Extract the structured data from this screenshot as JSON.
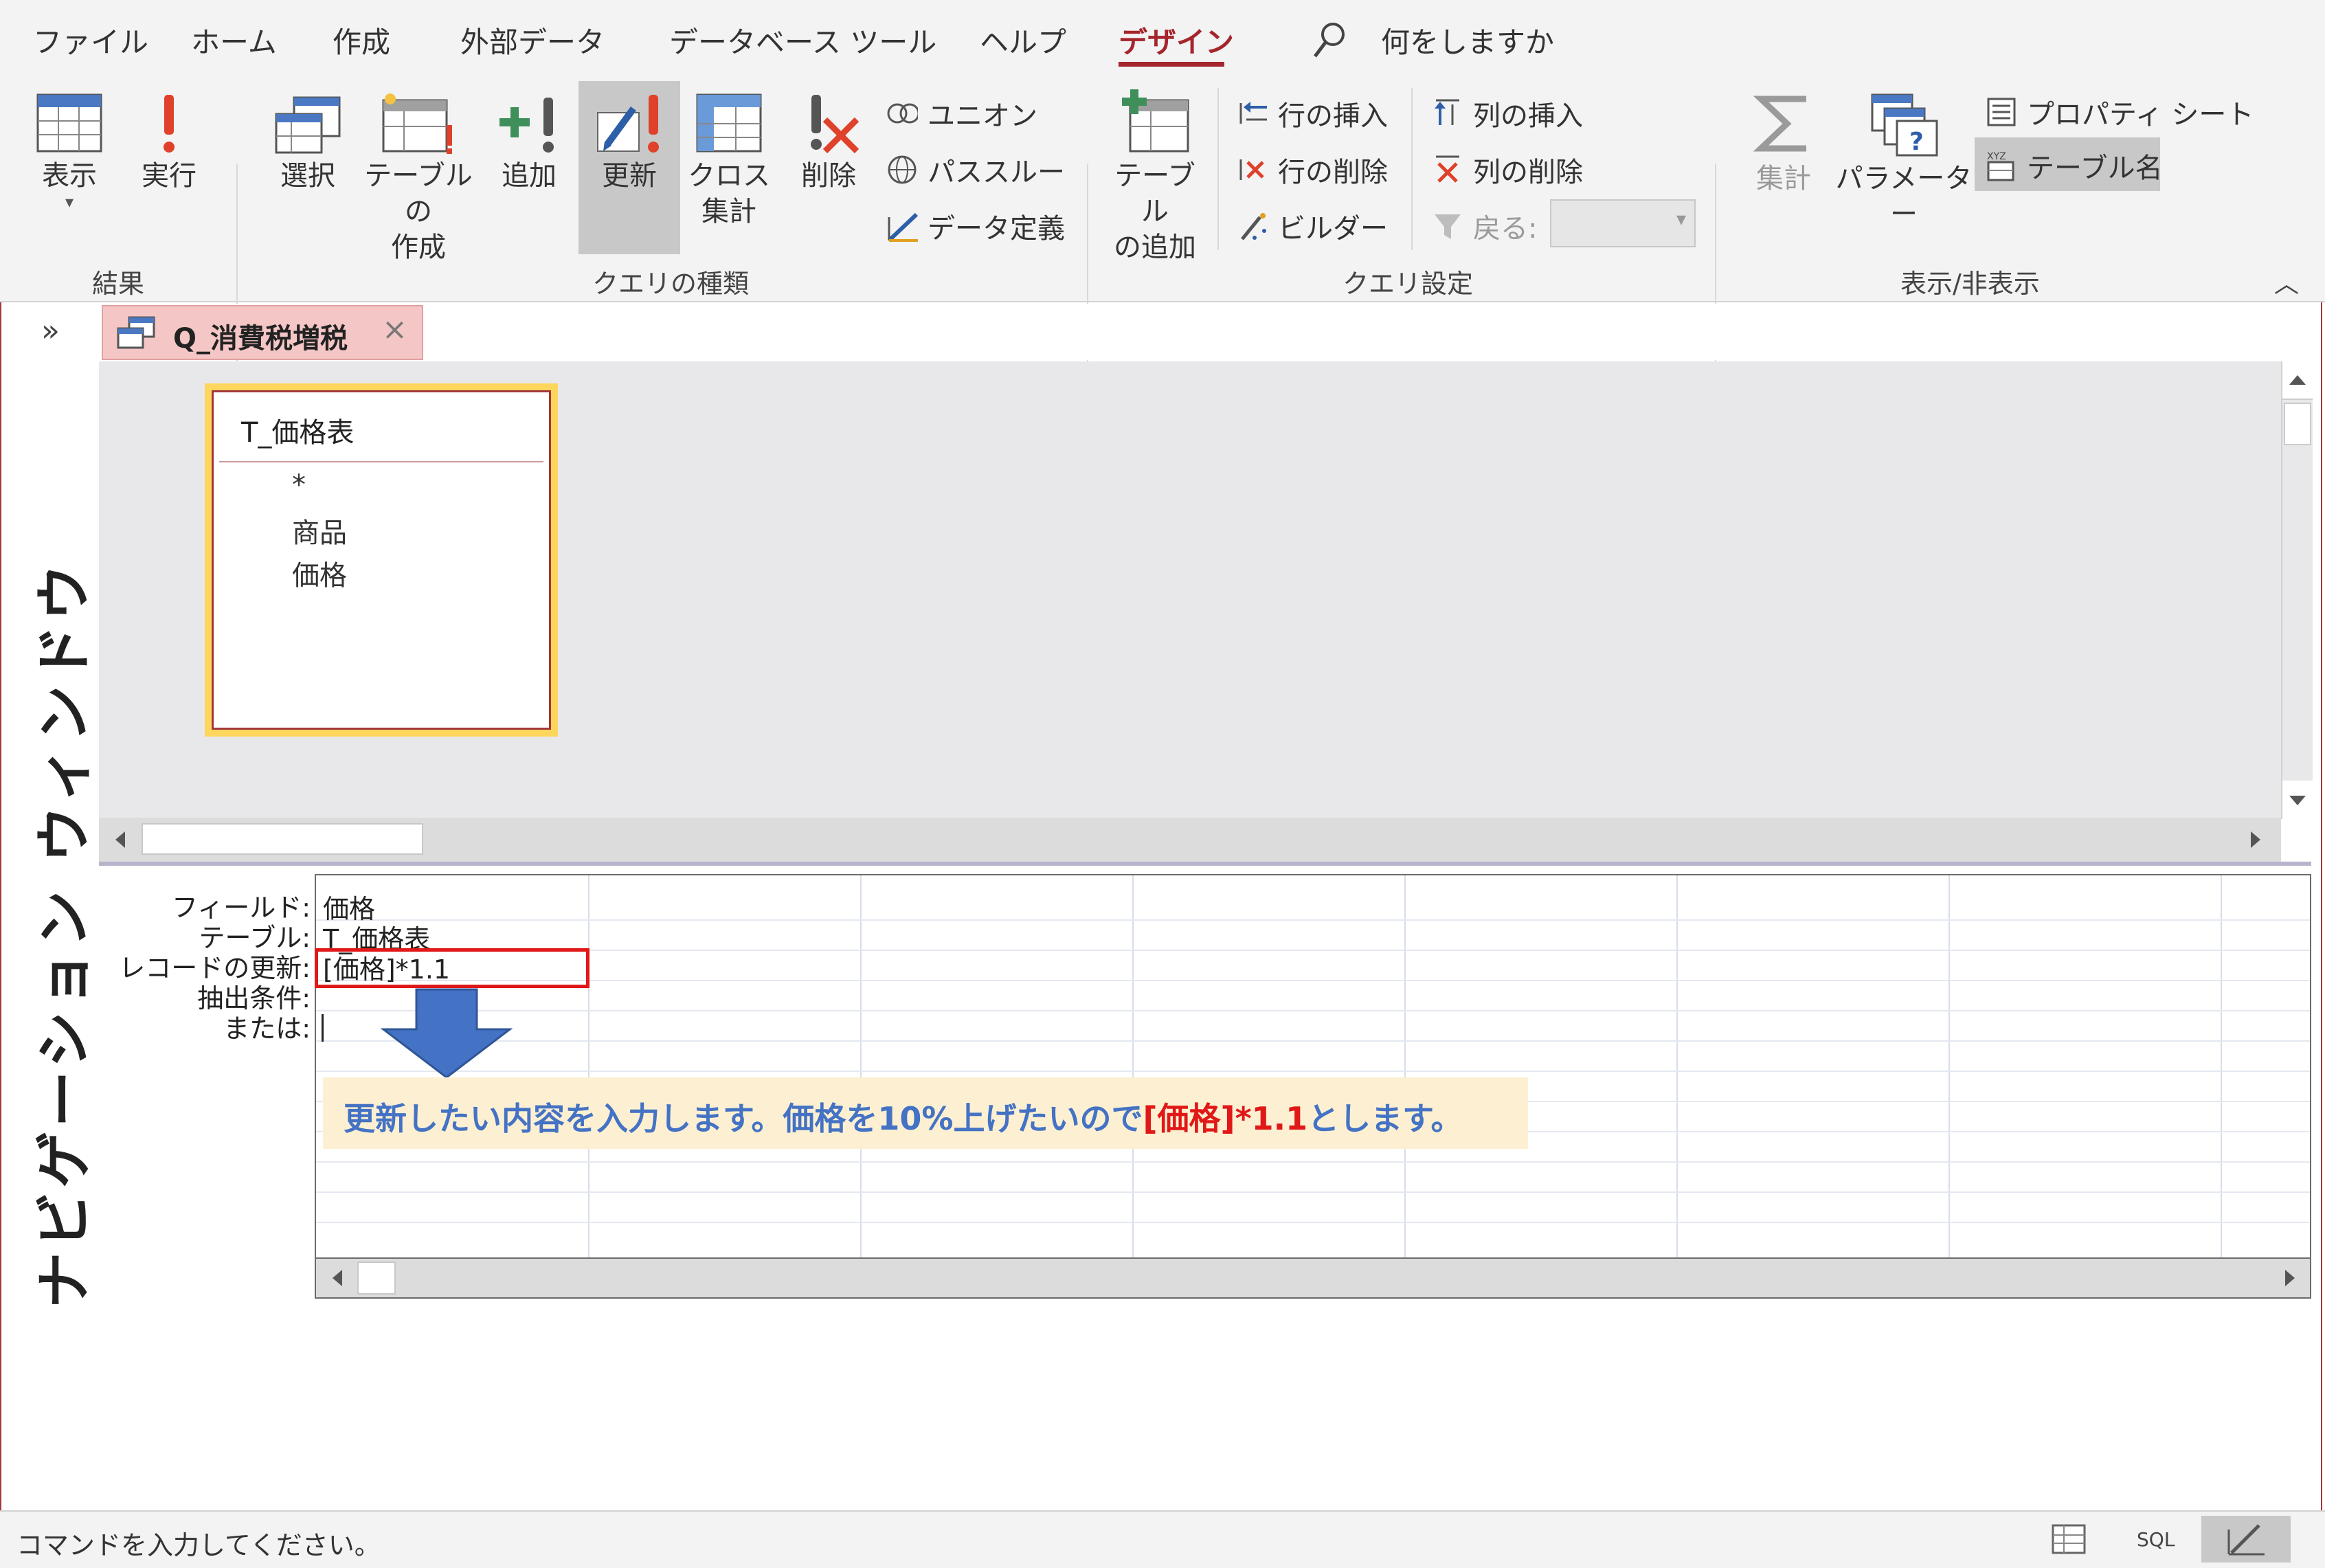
{
  "menu": {
    "items": [
      "ファイル",
      "ホーム",
      "作成",
      "外部データ",
      "データベース ツール",
      "ヘルプ",
      "デザイン"
    ],
    "search_label": "何をしますか"
  },
  "ribbon": {
    "results": {
      "view": "表示",
      "run": "実行",
      "group": "結果"
    },
    "query_type": {
      "select": "選択",
      "make_table_1": "テーブルの",
      "make_table_2": "作成",
      "append": "追加",
      "update": "更新",
      "crosstab_1": "クロス",
      "crosstab_2": "集計",
      "delete": "削除",
      "union": "ユニオン",
      "passthrough": "パススルー",
      "data_definition": "データ定義",
      "group": "クエリの種類"
    },
    "query_setup": {
      "show_table_1": "テーブル",
      "show_table_2": "の追加",
      "insert_rows": "行の挿入",
      "delete_rows": "行の削除",
      "builder": "ビルダー",
      "insert_columns": "列の挿入",
      "delete_columns": "列の削除",
      "return": "戻る:",
      "group": "クエリ設定"
    },
    "show_hide": {
      "totals": "集計",
      "parameters": "パラメーター",
      "property_sheet": "プロパティ シート",
      "table_names": "テーブル名",
      "group": "表示/非表示"
    }
  },
  "document_tab": {
    "title": "Q_消費税増税"
  },
  "navigation_pane": {
    "label": "ナビゲーション ウィンドウ"
  },
  "table_box": {
    "title": "T_価格表",
    "fields": [
      "*",
      "商品",
      "価格"
    ]
  },
  "design_grid": {
    "row_labels": [
      "フィールド:",
      "テーブル:",
      "レコードの更新:",
      "抽出条件:",
      "または:"
    ],
    "column1": {
      "field": "価格",
      "table": "T_価格表",
      "update_to": "[価格]*1.1"
    }
  },
  "callout": {
    "text_before": "更新したい内容を入力します。価格を10%上げたいので",
    "highlight": "[価格]*1.1",
    "text_after": "とします。"
  },
  "status_bar": {
    "text": "コマンドを入力してください。",
    "sql_label": "SQL"
  }
}
